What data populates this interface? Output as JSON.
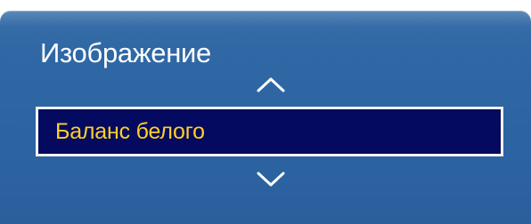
{
  "menu": {
    "title": "Изображение",
    "selected_item_label": "Баланс белого",
    "icons": {
      "up": "chevron-up-icon",
      "down": "chevron-down-icon"
    }
  },
  "colors": {
    "panel": "#2c64a2",
    "selection_background": "#030a5f",
    "selection_border": "#f4f4f4",
    "selection_text": "#ffcf29",
    "title_text": "#ffffff"
  }
}
